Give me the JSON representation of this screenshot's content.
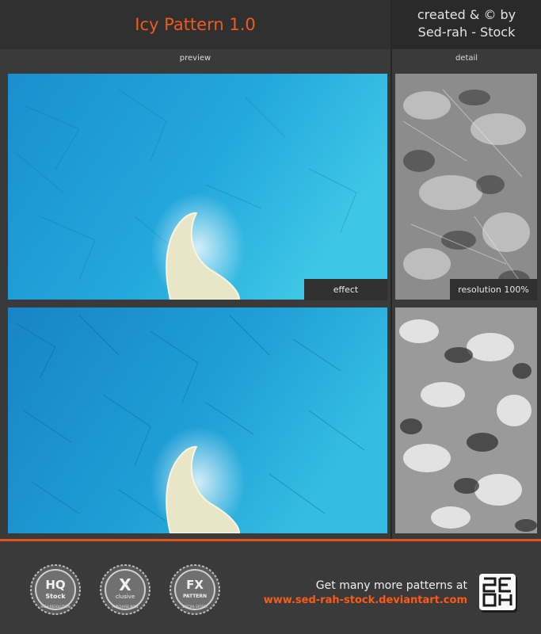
{
  "header": {
    "title": "Icy Pattern 1.0",
    "credit_line1": "created & © by",
    "credit_line2": "Sed-rah - Stock"
  },
  "labels": {
    "preview": "preview",
    "detail": "detail",
    "effect": "effect",
    "resolution": "resolution 100%"
  },
  "badges": [
    {
      "main": "HQ",
      "sub": "Stock",
      "ring": "HIGH RESOLUTION"
    },
    {
      "main": "X",
      "sub": "clusive",
      "ring": "PURCHASE NOW"
    },
    {
      "main": "FX",
      "sub": "PATTERN",
      "ring": "SPECIAL EFFECT"
    }
  ],
  "footer": {
    "promo": "Get many more patterns at",
    "url": "www.sed-rah-stock.deviantart.com"
  },
  "colors": {
    "accent": "#f05a1e",
    "ice_blue": "#1fa6d8",
    "dark_panel": "#303030"
  }
}
